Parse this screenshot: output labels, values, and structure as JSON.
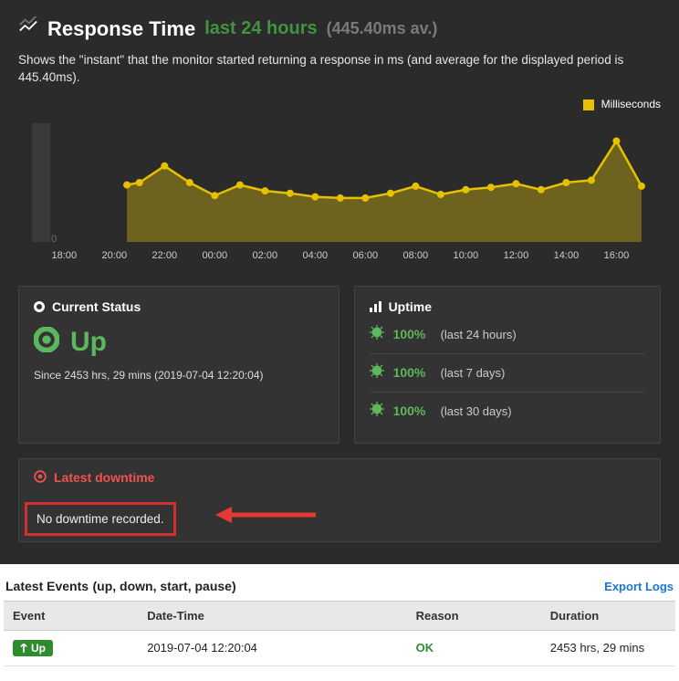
{
  "header": {
    "title": "Response Time",
    "range": "last 24 hours",
    "average": "(445.40ms av.)"
  },
  "description": "Shows the \"instant\" that the monitor started returning a response in ms (and average for the displayed period is 445.40ms).",
  "legend_label": "Milliseconds",
  "chart_data": {
    "type": "area",
    "title": "Response Time",
    "xlabel": "",
    "ylabel": "ms",
    "ylim": [
      0,
      1000
    ],
    "x": [
      "18:00",
      "20:00",
      "22:00",
      "00:00",
      "02:00",
      "04:00",
      "06:00",
      "08:00",
      "10:00",
      "12:00",
      "14:00",
      "16:00"
    ],
    "series": [
      {
        "name": "Milliseconds",
        "color": "#e5c100",
        "points": [
          {
            "x": "20:30",
            "y": 480
          },
          {
            "x": "21:00",
            "y": 500
          },
          {
            "x": "22:00",
            "y": 640
          },
          {
            "x": "23:00",
            "y": 500
          },
          {
            "x": "00:00",
            "y": 390
          },
          {
            "x": "01:00",
            "y": 480
          },
          {
            "x": "02:00",
            "y": 430
          },
          {
            "x": "03:00",
            "y": 410
          },
          {
            "x": "04:00",
            "y": 380
          },
          {
            "x": "05:00",
            "y": 370
          },
          {
            "x": "06:00",
            "y": 370
          },
          {
            "x": "07:00",
            "y": 410
          },
          {
            "x": "08:00",
            "y": 470
          },
          {
            "x": "09:00",
            "y": 400
          },
          {
            "x": "10:00",
            "y": 440
          },
          {
            "x": "11:00",
            "y": 460
          },
          {
            "x": "12:00",
            "y": 490
          },
          {
            "x": "13:00",
            "y": 440
          },
          {
            "x": "14:00",
            "y": 500
          },
          {
            "x": "15:00",
            "y": 520
          },
          {
            "x": "16:00",
            "y": 850
          },
          {
            "x": "17:00",
            "y": 470
          }
        ]
      }
    ]
  },
  "current_status": {
    "heading": "Current Status",
    "value": "Up",
    "since": "Since 2453 hrs, 29 mins (2019-07-04 12:20:04)"
  },
  "uptime": {
    "heading": "Uptime",
    "rows": [
      {
        "pct": "100%",
        "label": "(last 24 hours)"
      },
      {
        "pct": "100%",
        "label": "(last 7 days)"
      },
      {
        "pct": "100%",
        "label": "(last 30 days)"
      }
    ]
  },
  "downtime": {
    "heading": "Latest downtime",
    "body": "No downtime recorded."
  },
  "events": {
    "title": "Latest Events",
    "subtitle": "(up, down, start, pause)",
    "export_label": "Export Logs",
    "columns": {
      "event": "Event",
      "datetime": "Date-Time",
      "reason": "Reason",
      "duration": "Duration"
    },
    "rows": [
      {
        "event": "Up",
        "datetime": "2019-07-04 12:20:04",
        "reason": "OK",
        "duration": "2453 hrs, 29 mins"
      }
    ]
  }
}
